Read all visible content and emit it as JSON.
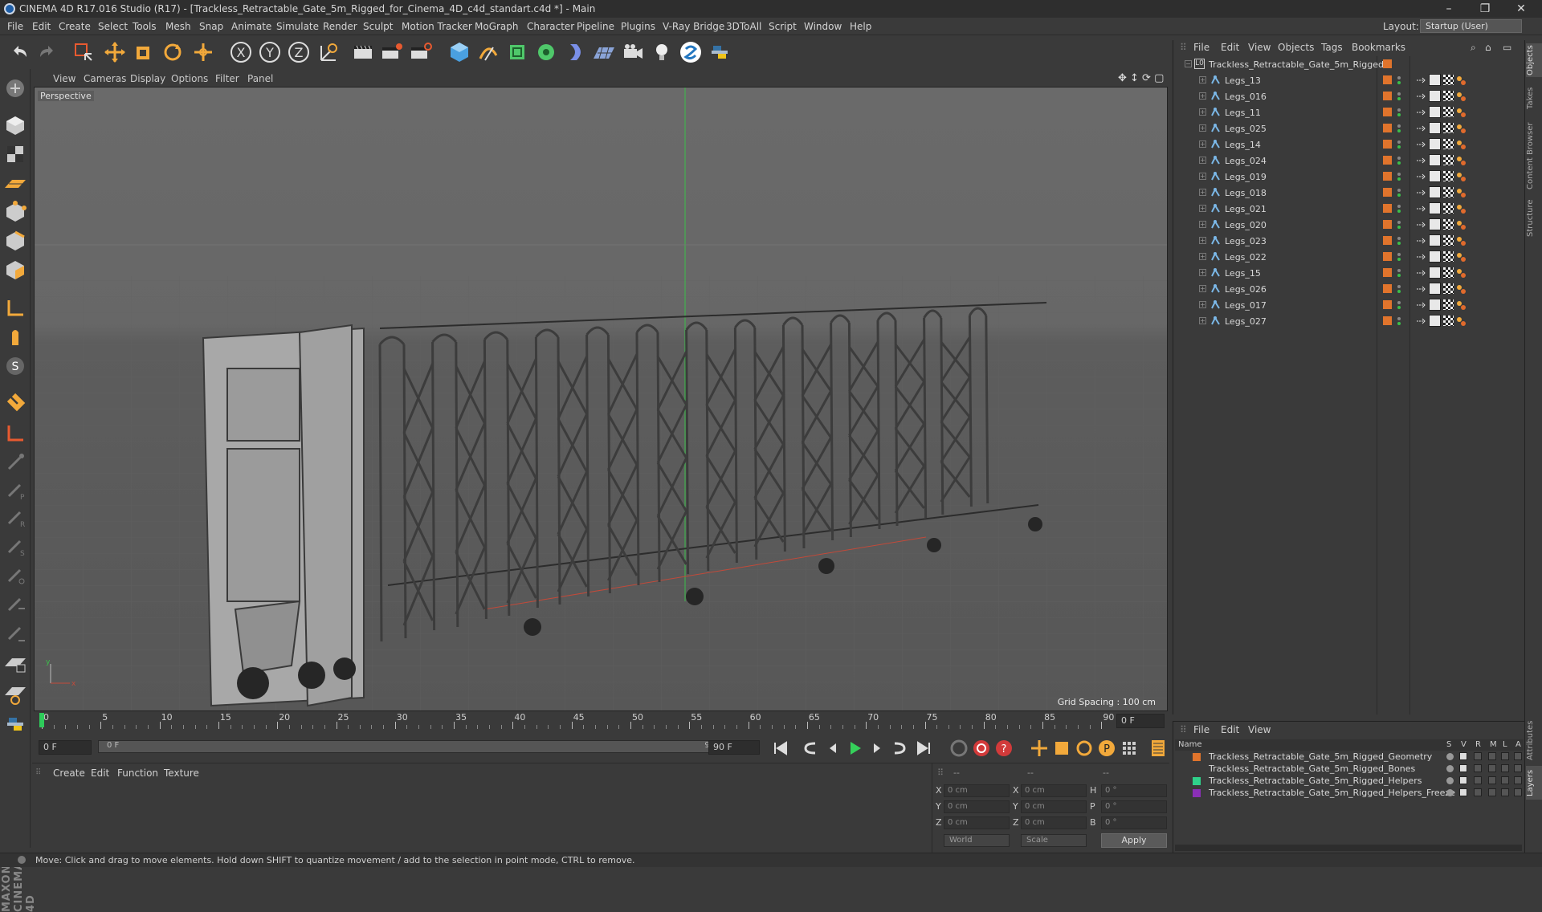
{
  "window": {
    "title": "CINEMA 4D R17.016 Studio (R17) - [Trackless_Retractable_Gate_5m_Rigged_for_Cinema_4D_c4d_standart.c4d *] - Main",
    "minimize": "–",
    "restore": "❐",
    "close": "✕"
  },
  "menu": [
    "File",
    "Edit",
    "Create",
    "Select",
    "Tools",
    "Mesh",
    "Snap",
    "Animate",
    "Simulate",
    "Render",
    "Sculpt",
    "Motion Tracker",
    "MoGraph",
    "Character",
    "Pipeline",
    "Plugins",
    "V-Ray Bridge",
    "3DToAll",
    "Script",
    "Window",
    "Help"
  ],
  "layout": {
    "label": "Layout:",
    "value": "Startup (User)"
  },
  "viewport": {
    "menu": [
      "View",
      "Cameras",
      "Display",
      "Options",
      "Filter",
      "Panel"
    ],
    "label": "Perspective",
    "grid_spacing": "Grid Spacing : 100 cm",
    "axis_y": "y",
    "axis_x": "x"
  },
  "timeline": {
    "ticks": [
      "0",
      "5",
      "10",
      "15",
      "20",
      "25",
      "30",
      "35",
      "40",
      "45",
      "50",
      "55",
      "60",
      "65",
      "70",
      "75",
      "80",
      "85",
      "90"
    ],
    "end_field": "0 F"
  },
  "playback": {
    "start": "0 F",
    "range_start": "0 F",
    "range_end": "90 F",
    "end": "90 F"
  },
  "material": {
    "menu": [
      "Create",
      "Edit",
      "Function",
      "Texture"
    ]
  },
  "coords": {
    "head": [
      "--",
      "--",
      "--"
    ],
    "rows": [
      {
        "a": "X",
        "av": "0 cm",
        "b": "X",
        "bv": "0 cm",
        "c": "H",
        "cv": "0 °"
      },
      {
        "a": "Y",
        "av": "0 cm",
        "b": "Y",
        "bv": "0 cm",
        "c": "P",
        "cv": "0 °"
      },
      {
        "a": "Z",
        "av": "0 cm",
        "b": "Z",
        "bv": "0 cm",
        "c": "B",
        "cv": "0 °"
      }
    ],
    "world": "World",
    "scale": "Scale",
    "apply": "Apply"
  },
  "status": "Move: Click and drag to move elements. Hold down SHIFT to quantize movement / add to the selection in point mode, CTRL to remove.",
  "objects": {
    "menu": [
      "File",
      "Edit",
      "View",
      "Objects",
      "Tags",
      "Bookmarks"
    ],
    "root": "Trackless_Retractable_Gate_5m_Rigged",
    "items": [
      "Legs_13",
      "Legs_016",
      "Legs_11",
      "Legs_025",
      "Legs_14",
      "Legs_024",
      "Legs_019",
      "Legs_018",
      "Legs_021",
      "Legs_020",
      "Legs_023",
      "Legs_022",
      "Legs_15",
      "Legs_026",
      "Legs_017",
      "Legs_027"
    ]
  },
  "right_tabs": [
    "Objects",
    "Takes",
    "Content Browser",
    "Structure"
  ],
  "right_tabs_lower": [
    "Attributes",
    "Layers"
  ],
  "layers": {
    "menu": [
      "File",
      "Edit",
      "View"
    ],
    "headers": [
      "Name",
      "S",
      "V",
      "R",
      "M",
      "L",
      "A"
    ],
    "items": [
      {
        "name": "Trackless_Retractable_Gate_5m_Rigged_Geometry",
        "color": "#e0742c"
      },
      {
        "name": "Trackless_Retractable_Gate_5m_Rigged_Bones",
        "color": "#3a3a3a"
      },
      {
        "name": "Trackless_Retractable_Gate_5m_Rigged_Helpers",
        "color": "#2fd18a"
      },
      {
        "name": "Trackless_Retractable_Gate_5m_Rigged_Helpers_Freeze",
        "color": "#8a2fb6"
      }
    ]
  },
  "logo": "MAXON CINEMA 4D"
}
